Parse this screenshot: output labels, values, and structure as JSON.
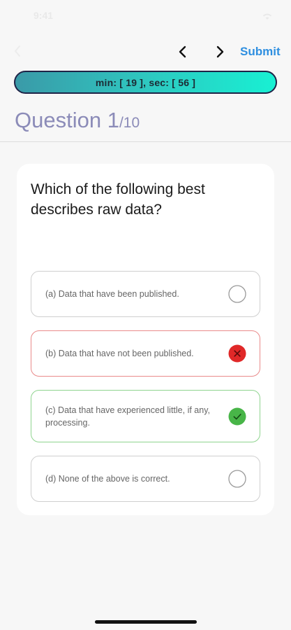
{
  "status_bar": {
    "time": "9:41"
  },
  "nav": {
    "submit_label": "Submit"
  },
  "timer": {
    "text": "min: [ 19 ], sec: [ 56 ]"
  },
  "question": {
    "label": "Question 1",
    "total": "/10",
    "text": "Which of the following best describes raw data?"
  },
  "options": [
    {
      "label": "(a) Data that have been published.",
      "state": "unselected",
      "icon": "empty-radio-icon"
    },
    {
      "label": "(b) Data that have not been published.",
      "state": "wrong",
      "icon": "wrong-x-icon"
    },
    {
      "label": "(c) Data that have experienced little, if any, processing.",
      "state": "correct",
      "icon": "correct-check-icon"
    },
    {
      "label": "(d) None of the above is correct.",
      "state": "unselected",
      "icon": "empty-radio-icon"
    }
  ],
  "colors": {
    "accent": "#2f8fe0",
    "wrong": "#e02828",
    "correct": "#48b548",
    "heading": "#8b8bb8"
  }
}
